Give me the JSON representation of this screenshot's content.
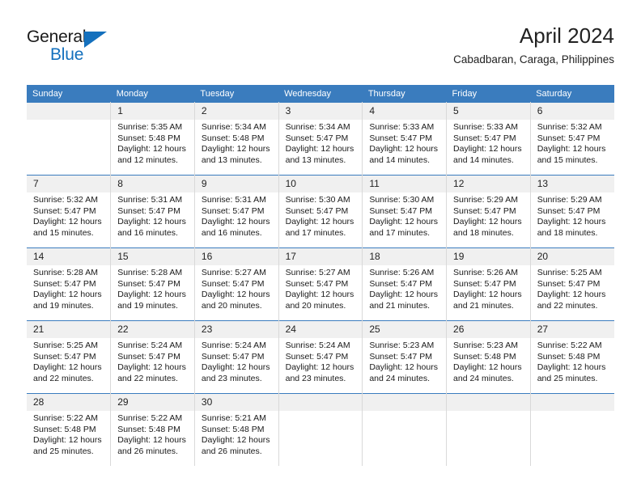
{
  "brand": {
    "name_top": "General",
    "name_bottom": "Blue",
    "accent_color": "#1470bd"
  },
  "header": {
    "title": "April 2024",
    "subtitle": "Cabadbaran, Caraga, Philippines"
  },
  "theme": {
    "header_row_bg": "#3a7cbe",
    "header_row_text": "#ffffff",
    "daynum_bg": "#f0f0f0",
    "cell_border": "#d9d9d9",
    "row_top_border": "#3a7cbe"
  },
  "weekdays": [
    "Sunday",
    "Monday",
    "Tuesday",
    "Wednesday",
    "Thursday",
    "Friday",
    "Saturday"
  ],
  "labels": {
    "sunrise": "Sunrise:",
    "sunset": "Sunset:",
    "daylight": "Daylight:"
  },
  "weeks": [
    [
      {
        "day": "",
        "l1": "",
        "l2": "",
        "l3": "",
        "l4": ""
      },
      {
        "day": "1",
        "l1": "Sunrise: 5:35 AM",
        "l2": "Sunset: 5:48 PM",
        "l3": "Daylight: 12 hours",
        "l4": "and 12 minutes."
      },
      {
        "day": "2",
        "l1": "Sunrise: 5:34 AM",
        "l2": "Sunset: 5:48 PM",
        "l3": "Daylight: 12 hours",
        "l4": "and 13 minutes."
      },
      {
        "day": "3",
        "l1": "Sunrise: 5:34 AM",
        "l2": "Sunset: 5:47 PM",
        "l3": "Daylight: 12 hours",
        "l4": "and 13 minutes."
      },
      {
        "day": "4",
        "l1": "Sunrise: 5:33 AM",
        "l2": "Sunset: 5:47 PM",
        "l3": "Daylight: 12 hours",
        "l4": "and 14 minutes."
      },
      {
        "day": "5",
        "l1": "Sunrise: 5:33 AM",
        "l2": "Sunset: 5:47 PM",
        "l3": "Daylight: 12 hours",
        "l4": "and 14 minutes."
      },
      {
        "day": "6",
        "l1": "Sunrise: 5:32 AM",
        "l2": "Sunset: 5:47 PM",
        "l3": "Daylight: 12 hours",
        "l4": "and 15 minutes."
      }
    ],
    [
      {
        "day": "7",
        "l1": "Sunrise: 5:32 AM",
        "l2": "Sunset: 5:47 PM",
        "l3": "Daylight: 12 hours",
        "l4": "and 15 minutes."
      },
      {
        "day": "8",
        "l1": "Sunrise: 5:31 AM",
        "l2": "Sunset: 5:47 PM",
        "l3": "Daylight: 12 hours",
        "l4": "and 16 minutes."
      },
      {
        "day": "9",
        "l1": "Sunrise: 5:31 AM",
        "l2": "Sunset: 5:47 PM",
        "l3": "Daylight: 12 hours",
        "l4": "and 16 minutes."
      },
      {
        "day": "10",
        "l1": "Sunrise: 5:30 AM",
        "l2": "Sunset: 5:47 PM",
        "l3": "Daylight: 12 hours",
        "l4": "and 17 minutes."
      },
      {
        "day": "11",
        "l1": "Sunrise: 5:30 AM",
        "l2": "Sunset: 5:47 PM",
        "l3": "Daylight: 12 hours",
        "l4": "and 17 minutes."
      },
      {
        "day": "12",
        "l1": "Sunrise: 5:29 AM",
        "l2": "Sunset: 5:47 PM",
        "l3": "Daylight: 12 hours",
        "l4": "and 18 minutes."
      },
      {
        "day": "13",
        "l1": "Sunrise: 5:29 AM",
        "l2": "Sunset: 5:47 PM",
        "l3": "Daylight: 12 hours",
        "l4": "and 18 minutes."
      }
    ],
    [
      {
        "day": "14",
        "l1": "Sunrise: 5:28 AM",
        "l2": "Sunset: 5:47 PM",
        "l3": "Daylight: 12 hours",
        "l4": "and 19 minutes."
      },
      {
        "day": "15",
        "l1": "Sunrise: 5:28 AM",
        "l2": "Sunset: 5:47 PM",
        "l3": "Daylight: 12 hours",
        "l4": "and 19 minutes."
      },
      {
        "day": "16",
        "l1": "Sunrise: 5:27 AM",
        "l2": "Sunset: 5:47 PM",
        "l3": "Daylight: 12 hours",
        "l4": "and 20 minutes."
      },
      {
        "day": "17",
        "l1": "Sunrise: 5:27 AM",
        "l2": "Sunset: 5:47 PM",
        "l3": "Daylight: 12 hours",
        "l4": "and 20 minutes."
      },
      {
        "day": "18",
        "l1": "Sunrise: 5:26 AM",
        "l2": "Sunset: 5:47 PM",
        "l3": "Daylight: 12 hours",
        "l4": "and 21 minutes."
      },
      {
        "day": "19",
        "l1": "Sunrise: 5:26 AM",
        "l2": "Sunset: 5:47 PM",
        "l3": "Daylight: 12 hours",
        "l4": "and 21 minutes."
      },
      {
        "day": "20",
        "l1": "Sunrise: 5:25 AM",
        "l2": "Sunset: 5:47 PM",
        "l3": "Daylight: 12 hours",
        "l4": "and 22 minutes."
      }
    ],
    [
      {
        "day": "21",
        "l1": "Sunrise: 5:25 AM",
        "l2": "Sunset: 5:47 PM",
        "l3": "Daylight: 12 hours",
        "l4": "and 22 minutes."
      },
      {
        "day": "22",
        "l1": "Sunrise: 5:24 AM",
        "l2": "Sunset: 5:47 PM",
        "l3": "Daylight: 12 hours",
        "l4": "and 22 minutes."
      },
      {
        "day": "23",
        "l1": "Sunrise: 5:24 AM",
        "l2": "Sunset: 5:47 PM",
        "l3": "Daylight: 12 hours",
        "l4": "and 23 minutes."
      },
      {
        "day": "24",
        "l1": "Sunrise: 5:24 AM",
        "l2": "Sunset: 5:47 PM",
        "l3": "Daylight: 12 hours",
        "l4": "and 23 minutes."
      },
      {
        "day": "25",
        "l1": "Sunrise: 5:23 AM",
        "l2": "Sunset: 5:47 PM",
        "l3": "Daylight: 12 hours",
        "l4": "and 24 minutes."
      },
      {
        "day": "26",
        "l1": "Sunrise: 5:23 AM",
        "l2": "Sunset: 5:48 PM",
        "l3": "Daylight: 12 hours",
        "l4": "and 24 minutes."
      },
      {
        "day": "27",
        "l1": "Sunrise: 5:22 AM",
        "l2": "Sunset: 5:48 PM",
        "l3": "Daylight: 12 hours",
        "l4": "and 25 minutes."
      }
    ],
    [
      {
        "day": "28",
        "l1": "Sunrise: 5:22 AM",
        "l2": "Sunset: 5:48 PM",
        "l3": "Daylight: 12 hours",
        "l4": "and 25 minutes."
      },
      {
        "day": "29",
        "l1": "Sunrise: 5:22 AM",
        "l2": "Sunset: 5:48 PM",
        "l3": "Daylight: 12 hours",
        "l4": "and 26 minutes."
      },
      {
        "day": "30",
        "l1": "Sunrise: 5:21 AM",
        "l2": "Sunset: 5:48 PM",
        "l3": "Daylight: 12 hours",
        "l4": "and 26 minutes."
      },
      {
        "day": "",
        "l1": "",
        "l2": "",
        "l3": "",
        "l4": ""
      },
      {
        "day": "",
        "l1": "",
        "l2": "",
        "l3": "",
        "l4": ""
      },
      {
        "day": "",
        "l1": "",
        "l2": "",
        "l3": "",
        "l4": ""
      },
      {
        "day": "",
        "l1": "",
        "l2": "",
        "l3": "",
        "l4": ""
      }
    ]
  ]
}
